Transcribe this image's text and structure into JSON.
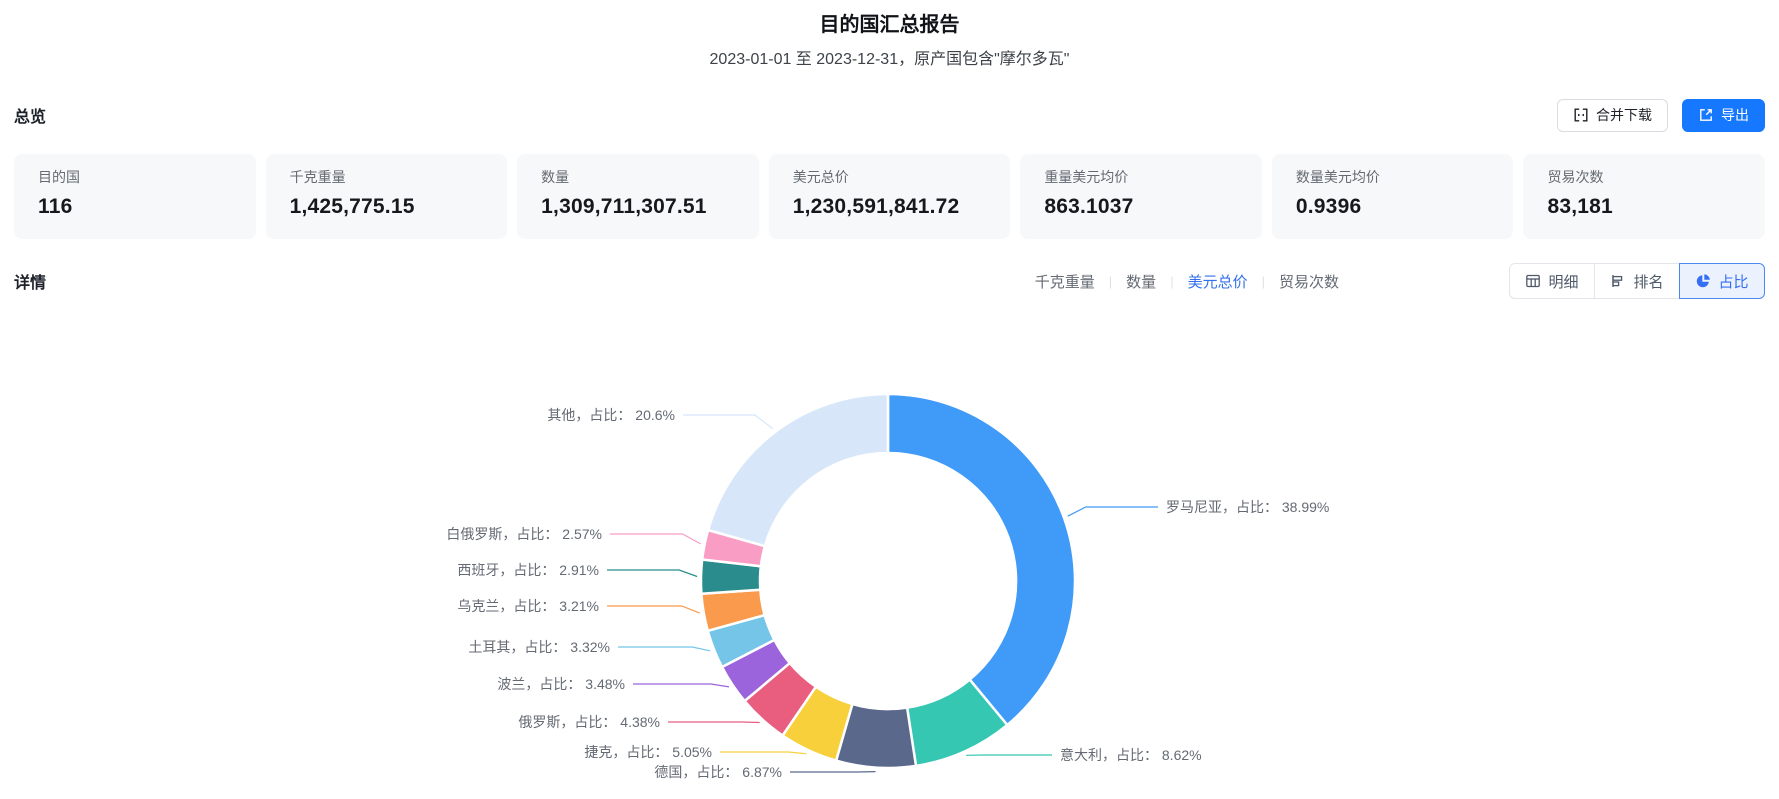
{
  "header": {
    "title": "目的国汇总报告",
    "subtitle": "2023-01-01 至 2023-12-31，原产国包含\"摩尔多瓦\""
  },
  "overview": {
    "heading": "总览",
    "buttons": [
      {
        "label": "合并下载",
        "icon": "merge-icon",
        "primary": false
      },
      {
        "label": "导出",
        "icon": "export-icon",
        "primary": true
      }
    ],
    "cards": [
      {
        "label": "目的国",
        "value": "116"
      },
      {
        "label": "千克重量",
        "value": "1,425,775.15"
      },
      {
        "label": "数量",
        "value": "1,309,711,307.51"
      },
      {
        "label": "美元总价",
        "value": "1,230,591,841.72"
      },
      {
        "label": "重量美元均价",
        "value": "863.1037"
      },
      {
        "label": "数量美元均价",
        "value": "0.9396"
      },
      {
        "label": "贸易次数",
        "value": "83,181"
      }
    ]
  },
  "details": {
    "heading": "详情",
    "metric_tabs": [
      {
        "label": "千克重量",
        "active": false
      },
      {
        "label": "数量",
        "active": false
      },
      {
        "label": "美元总价",
        "active": true
      },
      {
        "label": "贸易次数",
        "active": false
      }
    ],
    "view_buttons": [
      {
        "label": "明细",
        "icon": "table-icon",
        "active": false
      },
      {
        "label": "排名",
        "icon": "ranking-icon",
        "active": false
      },
      {
        "label": "占比",
        "icon": "pie-icon",
        "active": true
      }
    ]
  },
  "colors": {
    "accent_blue": "#1677ff",
    "tab_active_blue": "#3370eb",
    "view_active_blue": "#366ef4",
    "card_background": "#f7f8fa"
  },
  "chart_data": {
    "type": "pie",
    "donut": true,
    "title": "",
    "label_prefix": "占比",
    "legend": "none",
    "start_angle_deg": 0,
    "clockwise": true,
    "series": [
      {
        "name": "罗马尼亚",
        "pct": 38.99,
        "pct_text": "38.99",
        "color": "#409af8"
      },
      {
        "name": "意大利",
        "pct": 8.62,
        "pct_text": "8.62",
        "color": "#35c7b2"
      },
      {
        "name": "德国",
        "pct": 6.87,
        "pct_text": "6.87",
        "color": "#5a688c"
      },
      {
        "name": "捷克",
        "pct": 5.05,
        "pct_text": "5.05",
        "color": "#f7d03c"
      },
      {
        "name": "俄罗斯",
        "pct": 4.38,
        "pct_text": "4.38",
        "color": "#e95d7f"
      },
      {
        "name": "波兰",
        "pct": 3.48,
        "pct_text": "3.48",
        "color": "#9b63dc"
      },
      {
        "name": "土耳其",
        "pct": 3.32,
        "pct_text": "3.32",
        "color": "#74c5e8"
      },
      {
        "name": "乌克兰",
        "pct": 3.21,
        "pct_text": "3.21",
        "color": "#fa9a4c"
      },
      {
        "name": "西班牙",
        "pct": 2.91,
        "pct_text": "2.91",
        "color": "#2a8c8c"
      },
      {
        "name": "白俄罗斯",
        "pct": 2.57,
        "pct_text": "2.57",
        "color": "#fa9dc5"
      },
      {
        "name": "其他",
        "pct": 20.6,
        "pct_text": "20.6",
        "color": "#d7e7f9"
      }
    ]
  }
}
